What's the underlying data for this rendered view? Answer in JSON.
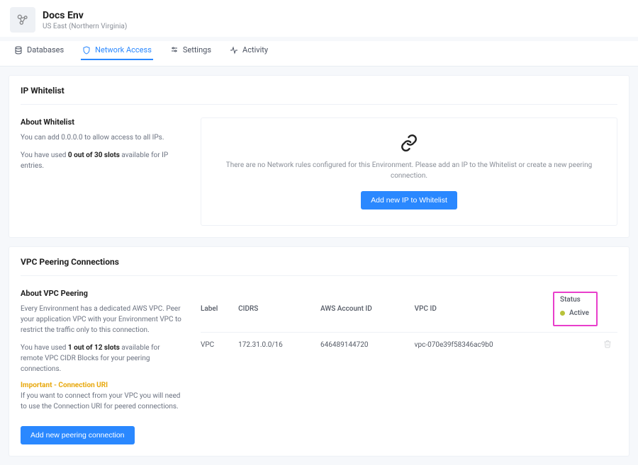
{
  "env": {
    "title": "Docs Env",
    "region": "US East (Northern Virginia)"
  },
  "tabs": {
    "databases": "Databases",
    "network": "Network Access",
    "settings": "Settings",
    "activity": "Activity"
  },
  "whitelist": {
    "heading": "IP Whitelist",
    "about_title": "About Whitelist",
    "line1": "You can add 0.0.0.0 to allow access to all IPs.",
    "line2_pre": "You have used ",
    "line2_bold": "0 out of 30 slots",
    "line2_post": " available for IP entries.",
    "empty_msg": "There are no Network rules configured for this Environment. Please add an IP to the Whitelist or create a new peering connection.",
    "add_btn": "Add new IP to Whitelist"
  },
  "vpc": {
    "heading": "VPC Peering Connections",
    "about_title": "About VPC Peering",
    "about_text": "Every Environment has a dedicated AWS VPC. Peer your application VPC with your Environment VPC to restrict the traffic only to this connection.",
    "slots_pre": "You have used ",
    "slots_bold": "1 out of 12 slots",
    "slots_post": " available for remote VPC CIDR Blocks for your peering connections.",
    "important_title": "Important - Connection URI",
    "important_text": "If you want to connect from your VPC you will need to use the Connection URI for peered connections.",
    "add_btn": "Add new peering connection",
    "columns": {
      "label": "Label",
      "cidrs": "CIDRS",
      "aws": "AWS Account ID",
      "vpcid": "VPC ID",
      "status": "Status"
    },
    "rows": [
      {
        "label": "VPC",
        "cidrs": "172.31.0.0/16",
        "aws": "646489144720",
        "vpcid": "vpc-070e39f58346ac9b0",
        "status": "Active",
        "status_color": "#b8c23a"
      }
    ]
  }
}
